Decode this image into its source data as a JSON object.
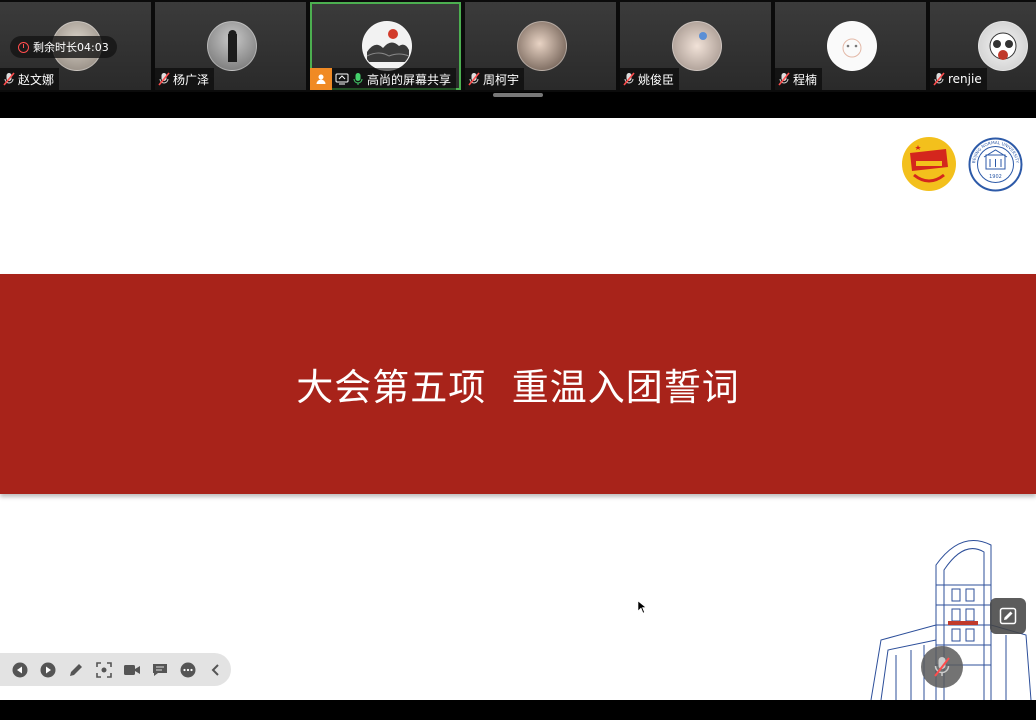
{
  "meeting": {
    "timer_label": "剩余时长04:03"
  },
  "participants": [
    {
      "name": "赵文娜",
      "mic": "muted",
      "icon": "mic-muted-icon"
    },
    {
      "name": "杨广泽",
      "mic": "muted",
      "icon": "mic-muted-icon"
    },
    {
      "name": "高尚的屏幕共享",
      "mic": "active",
      "icon": "mic-active-icon",
      "sharing": true
    },
    {
      "name": "周柯宇",
      "mic": "muted",
      "icon": "mic-muted-icon"
    },
    {
      "name": "姚俊臣",
      "mic": "muted",
      "icon": "mic-muted-icon"
    },
    {
      "name": "程楠",
      "mic": "muted",
      "icon": "mic-muted-icon"
    },
    {
      "name": "renjie",
      "mic": "muted",
      "icon": "mic-muted-icon"
    }
  ],
  "slide": {
    "title": "大会第五项  重温入团誓词",
    "band_color": "#a8231a",
    "logos": [
      "communist-youth-league-emblem",
      "beijing-normal-university-seal"
    ],
    "seal_text": "BEIJING NORMAL UNIVERSITY",
    "seal_year": "1902"
  },
  "toolbar": {
    "icons": [
      "prev-icon",
      "next-icon",
      "pen-icon",
      "screenshot-icon",
      "camera-icon",
      "chat-icon",
      "more-icon",
      "collapse-icon"
    ]
  },
  "colors": {
    "active_speaker_border": "#4caf50",
    "mic_muted": "#ff4d4d",
    "mic_active": "#44d16b"
  }
}
